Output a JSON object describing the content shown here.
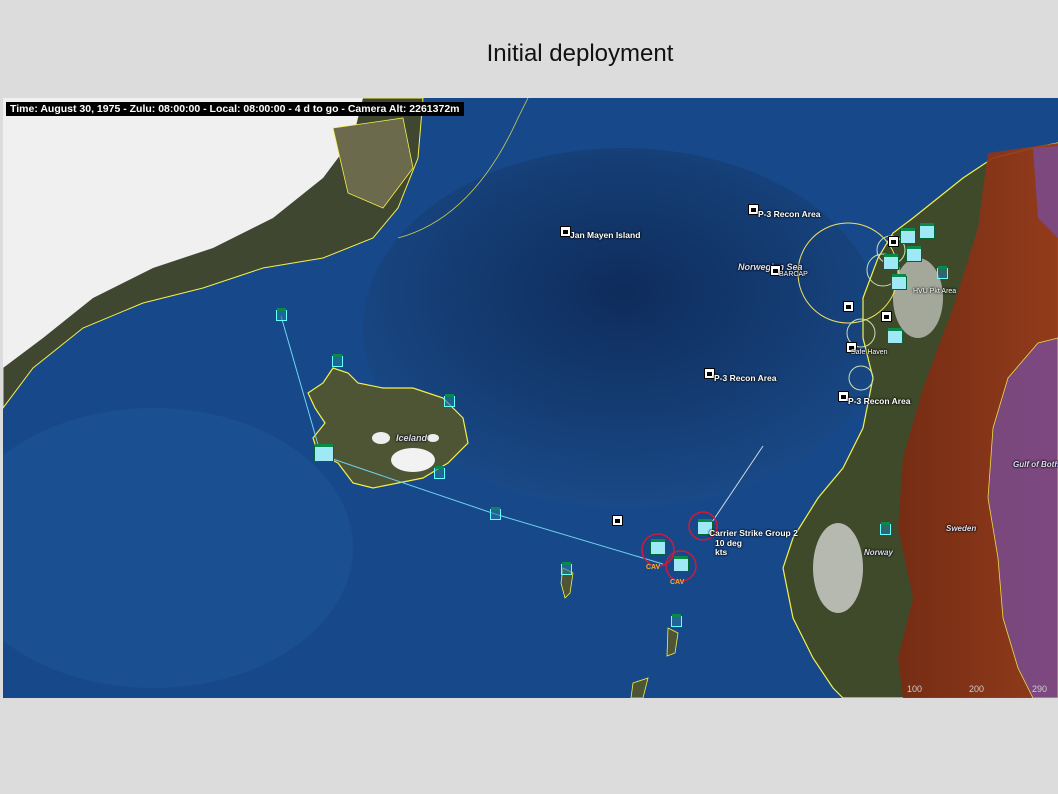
{
  "slide": {
    "title": "Initial deployment"
  },
  "status_bar": {
    "text": "Time: August 30, 1975 - Zulu: 08:00:00 - Local: 08:00:00 - 4 d to go -  Camera Alt: 2261372m"
  },
  "labels": {
    "jan_mayen": "Jan Mayen Island",
    "recon_north": "P-3 Recon Area",
    "norwegian_sea": "Norwegian Sea",
    "barcap": "BARCAP",
    "recon_mid": "P-3 Recon Area",
    "recon_coast": "P-3 Recon Area",
    "iceland": "Iceland",
    "carrier_group": "Carrier Strike Group 2",
    "course": "10 deg",
    "speed": "kts",
    "cv1": "CAV",
    "cv2": "CAV",
    "norway": "Norway",
    "sweden": "Sweden",
    "gulf": "Gulf of Both",
    "safe_haven": "Safe Haven",
    "hvu_area": "HVU Pkt Area",
    "scale_100": "100",
    "scale_200": "200",
    "scale_300": "290"
  },
  "colors": {
    "ocean": "#123a72",
    "ocean_deep": "#0f2d5c",
    "greenland_ice": "#f2f2f2",
    "land": "#3e4a2a",
    "sweden_overlay": "#8a2a16",
    "lake_overlay": "#7a4a8a",
    "coastline": "#f5f04a",
    "track_line": "#6fd3ee",
    "carrier_ring": "#d01a3a"
  },
  "icons": [
    "lock-icon",
    "airbase-icon",
    "carrier-icon",
    "sonobuoy-icon"
  ]
}
